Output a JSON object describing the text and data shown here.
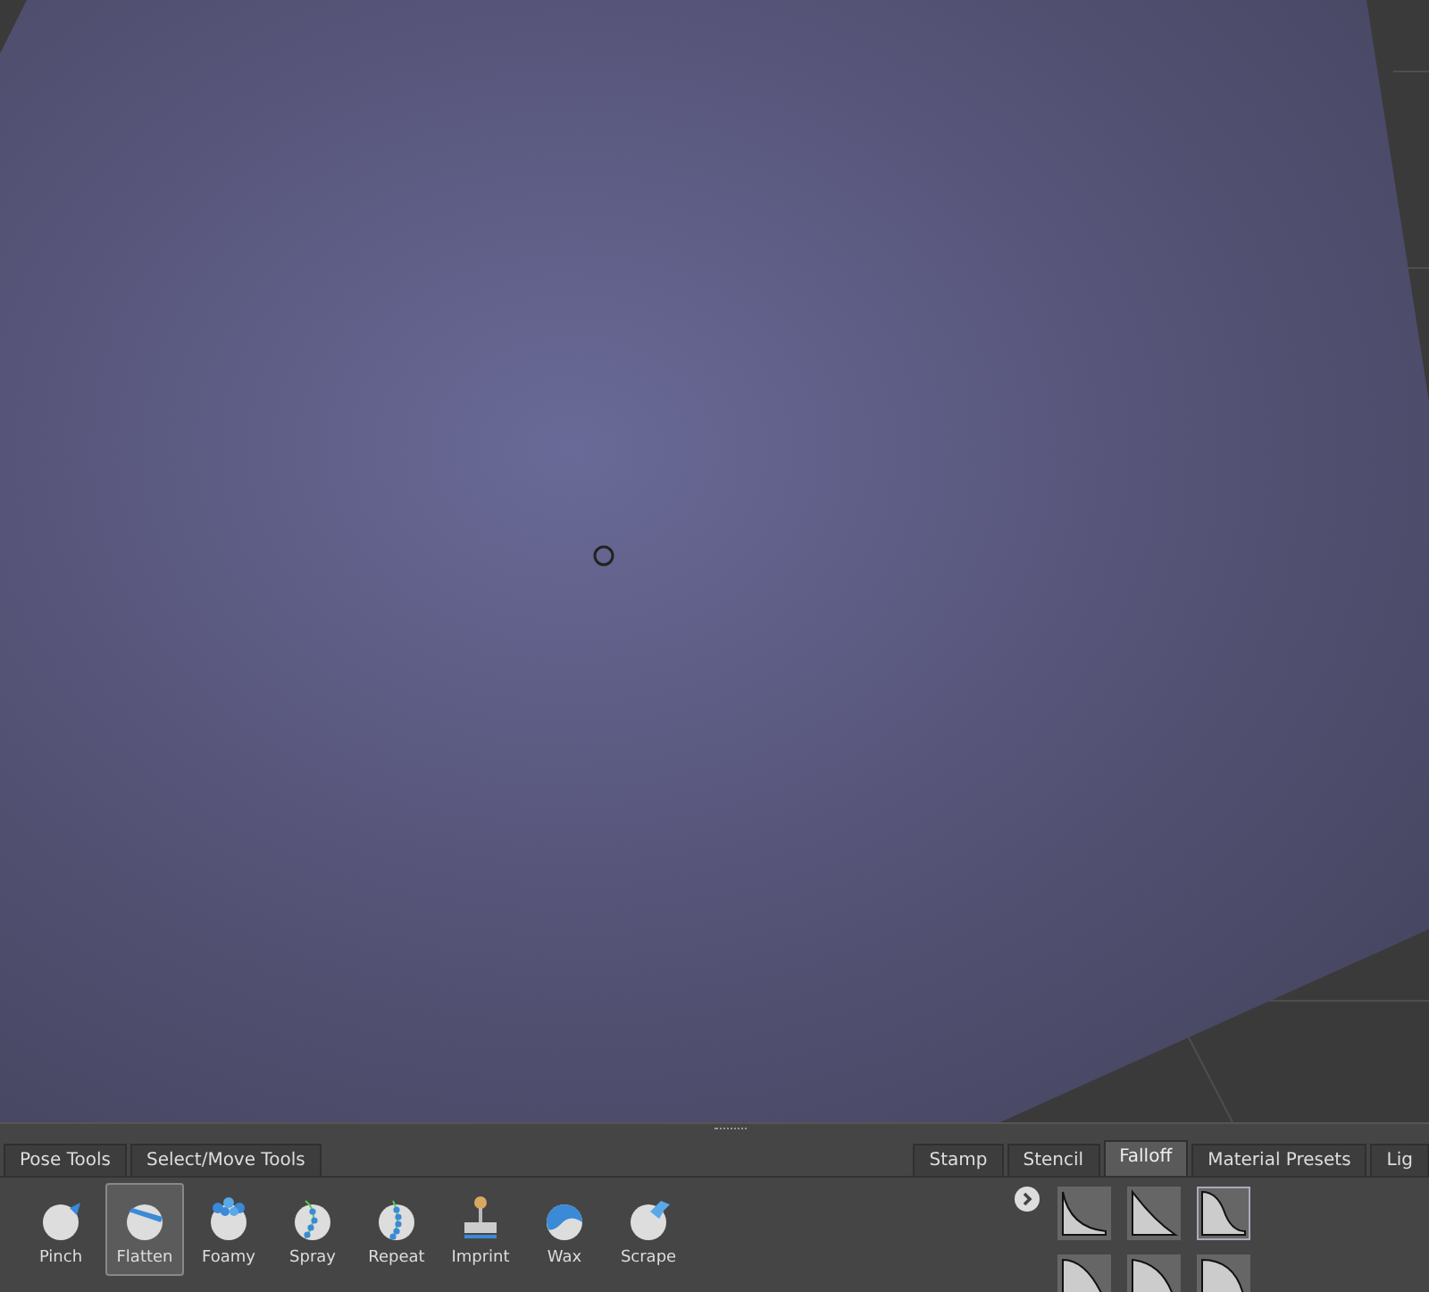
{
  "left_tabs": [
    {
      "label": "Pose Tools",
      "selected": false
    },
    {
      "label": "Select/Move Tools",
      "selected": false
    }
  ],
  "tools": [
    {
      "label": "Pinch",
      "kind": "pinch",
      "selected": false
    },
    {
      "label": "Flatten",
      "kind": "flatten",
      "selected": true
    },
    {
      "label": "Foamy",
      "kind": "foamy",
      "selected": false
    },
    {
      "label": "Spray",
      "kind": "spray",
      "selected": false
    },
    {
      "label": "Repeat",
      "kind": "repeat",
      "selected": false
    },
    {
      "label": "Imprint",
      "kind": "imprint",
      "selected": false
    },
    {
      "label": "Wax",
      "kind": "wax",
      "selected": false
    },
    {
      "label": "Scrape",
      "kind": "scrape",
      "selected": false
    }
  ],
  "right_tabs": [
    {
      "label": "Stamp",
      "selected": false
    },
    {
      "label": "Stencil",
      "selected": false
    },
    {
      "label": "Falloff",
      "selected": true
    },
    {
      "label": "Material Presets",
      "selected": false
    },
    {
      "label": "Lig",
      "selected": false
    }
  ],
  "falloff_presets": [
    {
      "selected": false
    },
    {
      "selected": false
    },
    {
      "selected": true
    },
    {
      "selected": false
    },
    {
      "selected": false
    },
    {
      "selected": false
    }
  ]
}
